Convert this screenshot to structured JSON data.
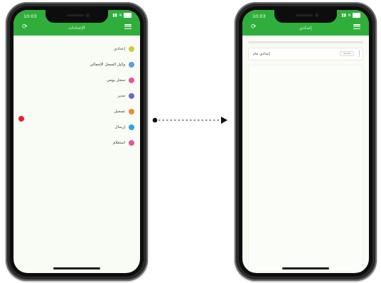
{
  "left_screen": {
    "time": "10:03",
    "title": "الإعدادات",
    "menu": [
      {
        "label": "إعدادي",
        "color": "#c7cf3c"
      },
      {
        "label": "وكيل السجل الإجمالي",
        "color": "#5a9de0"
      },
      {
        "label": "سجل يومي",
        "color": "#e5559d"
      },
      {
        "label": "مدير",
        "color": "#6a67c4"
      },
      {
        "label": "تسجيل",
        "color": "#f08a2c"
      },
      {
        "label": "إرسال",
        "color": "#2aa3e6"
      },
      {
        "label": "استعلام",
        "color": "#e5559d"
      }
    ],
    "notification_color": "#f01f2b"
  },
  "right_screen": {
    "time": "10:03",
    "title": "إعدادي",
    "field_label": "إعدادي عام",
    "field_value": "تحديد"
  },
  "colors": {
    "appbar": "#2fae3b"
  }
}
